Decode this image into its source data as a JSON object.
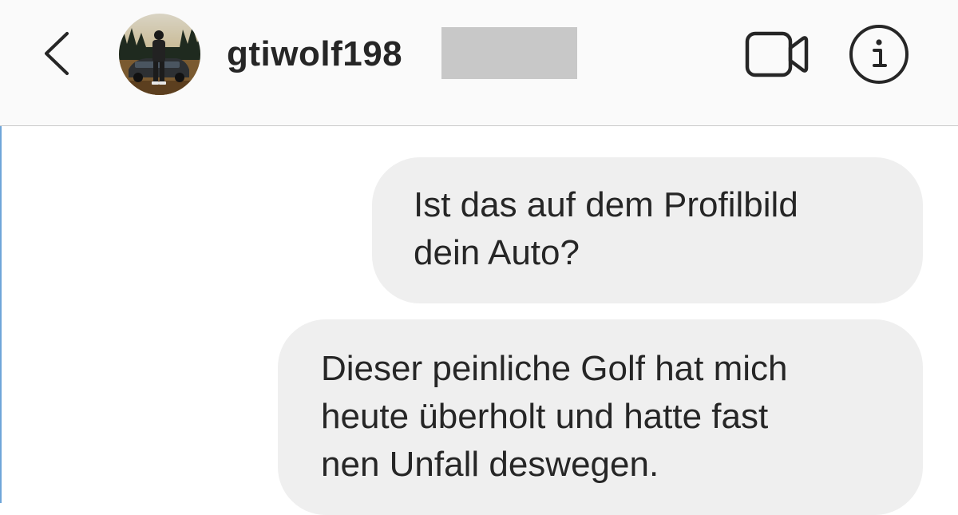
{
  "header": {
    "username": "gtiwolf198",
    "back_icon": "chevron-left-icon",
    "video_icon": "video-camera-icon",
    "info_icon": "info-icon"
  },
  "messages": [
    {
      "lines": [
        "Ist das auf dem Profilbild",
        "dein Auto?"
      ]
    },
    {
      "lines": [
        "Dieser peinliche Golf hat mich",
        "heute überholt und hatte fast",
        "nen Unfall deswegen."
      ]
    }
  ],
  "colors": {
    "header_bg": "#fafafa",
    "bubble_bg": "#efefef",
    "text": "#262626",
    "redaction": "#c8c8c8"
  }
}
